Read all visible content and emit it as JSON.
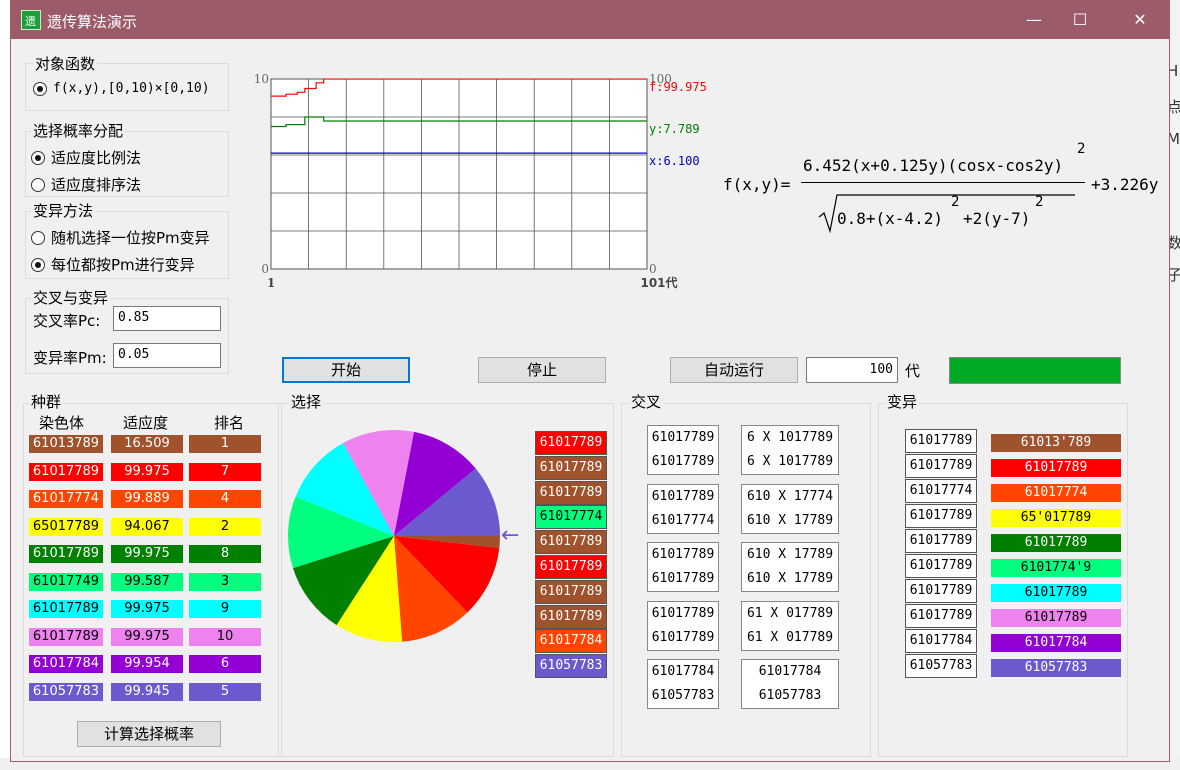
{
  "background": {
    "right_texts": [
      "H",
      "点",
      "M",
      "数",
      "子"
    ]
  },
  "window": {
    "title": "遗传算法演示",
    "icon_char": "遗",
    "minimize": "—",
    "maximize": "☐",
    "close": "✕"
  },
  "objective": {
    "title": "对象函数",
    "option": "f(x,y),[0,10)×[0,10)"
  },
  "selection_prob": {
    "title": "选择概率分配",
    "options": [
      "适应度比例法",
      "适应度排序法"
    ],
    "selected": 0
  },
  "mutation_method": {
    "title": "变异方法",
    "options": [
      "随机选择一位按Pm变异",
      "每位都按Pm进行变异"
    ],
    "selected": 1
  },
  "crossover_mutation": {
    "title": "交叉与变异",
    "pc_label": "交叉率Pc:",
    "pc_value": "0.85",
    "pm_label": "变异率Pm:",
    "pm_value": "0.05"
  },
  "chart_data": {
    "type": "line",
    "title": "",
    "x_start_label": "1",
    "x_end_label": "101代",
    "left_top_label": "10",
    "left_bottom_label": "0",
    "right_top_label": "100",
    "right_bottom_label": "0",
    "xlim": [
      1,
      101
    ],
    "ylim_left": [
      0,
      10
    ],
    "ylim_right": [
      0,
      100
    ],
    "grid": true,
    "series": [
      {
        "name": "f",
        "label": "f:99.975",
        "color": "#ff0000",
        "axis": "right",
        "x": [
          1,
          5,
          8,
          10,
          13,
          15,
          101
        ],
        "y": [
          91,
          92,
          93,
          95,
          98,
          99.975,
          99.975
        ]
      },
      {
        "name": "y",
        "label": "y:7.789",
        "color": "#008000",
        "axis": "left",
        "x": [
          1,
          5,
          8,
          10,
          13,
          15,
          101
        ],
        "y": [
          7.5,
          7.6,
          7.6,
          8.0,
          8.0,
          7.789,
          7.789
        ]
      },
      {
        "name": "x",
        "label": "x:6.100",
        "color": "#0000cc",
        "axis": "left",
        "x": [
          1,
          101
        ],
        "y": [
          6.1,
          6.1
        ]
      }
    ]
  },
  "formula": {
    "lhs": "f(x,y)=",
    "numerator": "6.452(x+0.125y)(cosx-cos2y)",
    "num_sup": "2",
    "denominator": "0.8+(x-4.2)",
    "den_sup1": "2",
    "den_mid": "+2(y-7)",
    "den_sup2": "2",
    "rhs": "+3.226y"
  },
  "controls": {
    "start": "开始",
    "stop": "停止",
    "auto": "自动运行",
    "generations": "100",
    "gen_unit": "代",
    "status_color": "#00aa22"
  },
  "population": {
    "title": "种群",
    "col_chromosome": "染色体",
    "col_fitness": "适应度",
    "col_rank": "排名",
    "rows": [
      {
        "chrom": "61013789",
        "fit": "16.509",
        "rank": "1",
        "color": "#a0522d"
      },
      {
        "chrom": "61017789",
        "fit": "99.975",
        "rank": "7",
        "color": "#ff0000"
      },
      {
        "chrom": "61017774",
        "fit": "99.889",
        "rank": "4",
        "color": "#ff4500"
      },
      {
        "chrom": "65017789",
        "fit": "94.067",
        "rank": "2",
        "color": "#ffff00"
      },
      {
        "chrom": "61017789",
        "fit": "99.975",
        "rank": "8",
        "color": "#008000"
      },
      {
        "chrom": "61017749",
        "fit": "99.587",
        "rank": "3",
        "color": "#00ff7f"
      },
      {
        "chrom": "61017789",
        "fit": "99.975",
        "rank": "9",
        "color": "#00ffff"
      },
      {
        "chrom": "61017789",
        "fit": "99.975",
        "rank": "10",
        "color": "#ee82ee"
      },
      {
        "chrom": "61017784",
        "fit": "99.954",
        "rank": "6",
        "color": "#9400d3"
      },
      {
        "chrom": "61057783",
        "fit": "99.945",
        "rank": "5",
        "color": "#6a5acd"
      }
    ],
    "calc_button": "计算选择概率"
  },
  "selection": {
    "title": "选择",
    "pie": [
      {
        "value": 16.509,
        "color": "#a0522d"
      },
      {
        "value": 99.975,
        "color": "#ff0000"
      },
      {
        "value": 99.889,
        "color": "#ff4500"
      },
      {
        "value": 94.067,
        "color": "#ffff00"
      },
      {
        "value": 99.975,
        "color": "#008000"
      },
      {
        "value": 99.587,
        "color": "#00ff7f"
      },
      {
        "value": 99.975,
        "color": "#00ffff"
      },
      {
        "value": 99.975,
        "color": "#ee82ee"
      },
      {
        "value": 99.954,
        "color": "#9400d3"
      },
      {
        "value": 99.945,
        "color": "#6a5acd"
      }
    ],
    "pointer": "←",
    "selected": [
      {
        "text": "61017789",
        "color": "#ff0000"
      },
      {
        "text": "61017789",
        "color": "#a0522d"
      },
      {
        "text": "61017789",
        "color": "#a0522d"
      },
      {
        "text": "61017774",
        "color": "#00ff7f"
      },
      {
        "text": "61017789",
        "color": "#a0522d"
      },
      {
        "text": "61017789",
        "color": "#ff0000"
      },
      {
        "text": "61017789",
        "color": "#a0522d"
      },
      {
        "text": "61017789",
        "color": "#a0522d"
      },
      {
        "text": "61017784",
        "color": "#ff4500"
      },
      {
        "text": "61057783",
        "color": "#6a5acd"
      }
    ]
  },
  "crossover": {
    "title": "交叉",
    "pairs": [
      {
        "left": [
          "61017789",
          "61017789"
        ],
        "right": [
          "6 X 1017789",
          "6 X 1017789"
        ]
      },
      {
        "left": [
          "61017789",
          "61017774"
        ],
        "right": [
          "610 X 17774",
          "610 X 17789"
        ]
      },
      {
        "left": [
          "61017789",
          "61017789"
        ],
        "right": [
          "610 X 17789",
          "610 X 17789"
        ]
      },
      {
        "left": [
          "61017789",
          "61017789"
        ],
        "right": [
          "61 X 017789",
          "61 X 017789"
        ]
      },
      {
        "left": [
          "61017784",
          "61057783"
        ],
        "right": [
          "61017784",
          "61057783"
        ]
      }
    ]
  },
  "mutation": {
    "title": "变异",
    "left": [
      "61017789",
      "61017789",
      "61017774",
      "61017789",
      "61017789",
      "61017789",
      "61017789",
      "61017789",
      "61017784",
      "61057783"
    ],
    "right": [
      {
        "text": "61013'789",
        "color": "#a0522d"
      },
      {
        "text": "61017789",
        "color": "#ff0000"
      },
      {
        "text": "61017774",
        "color": "#ff4500"
      },
      {
        "text": "65'017789",
        "color": "#ffff00"
      },
      {
        "text": "61017789",
        "color": "#008000"
      },
      {
        "text": "6101774'9",
        "color": "#00ff7f"
      },
      {
        "text": "61017789",
        "color": "#00ffff"
      },
      {
        "text": "61017789",
        "color": "#ee82ee"
      },
      {
        "text": "61017784",
        "color": "#9400d3"
      },
      {
        "text": "61057783",
        "color": "#6a5acd"
      }
    ]
  }
}
